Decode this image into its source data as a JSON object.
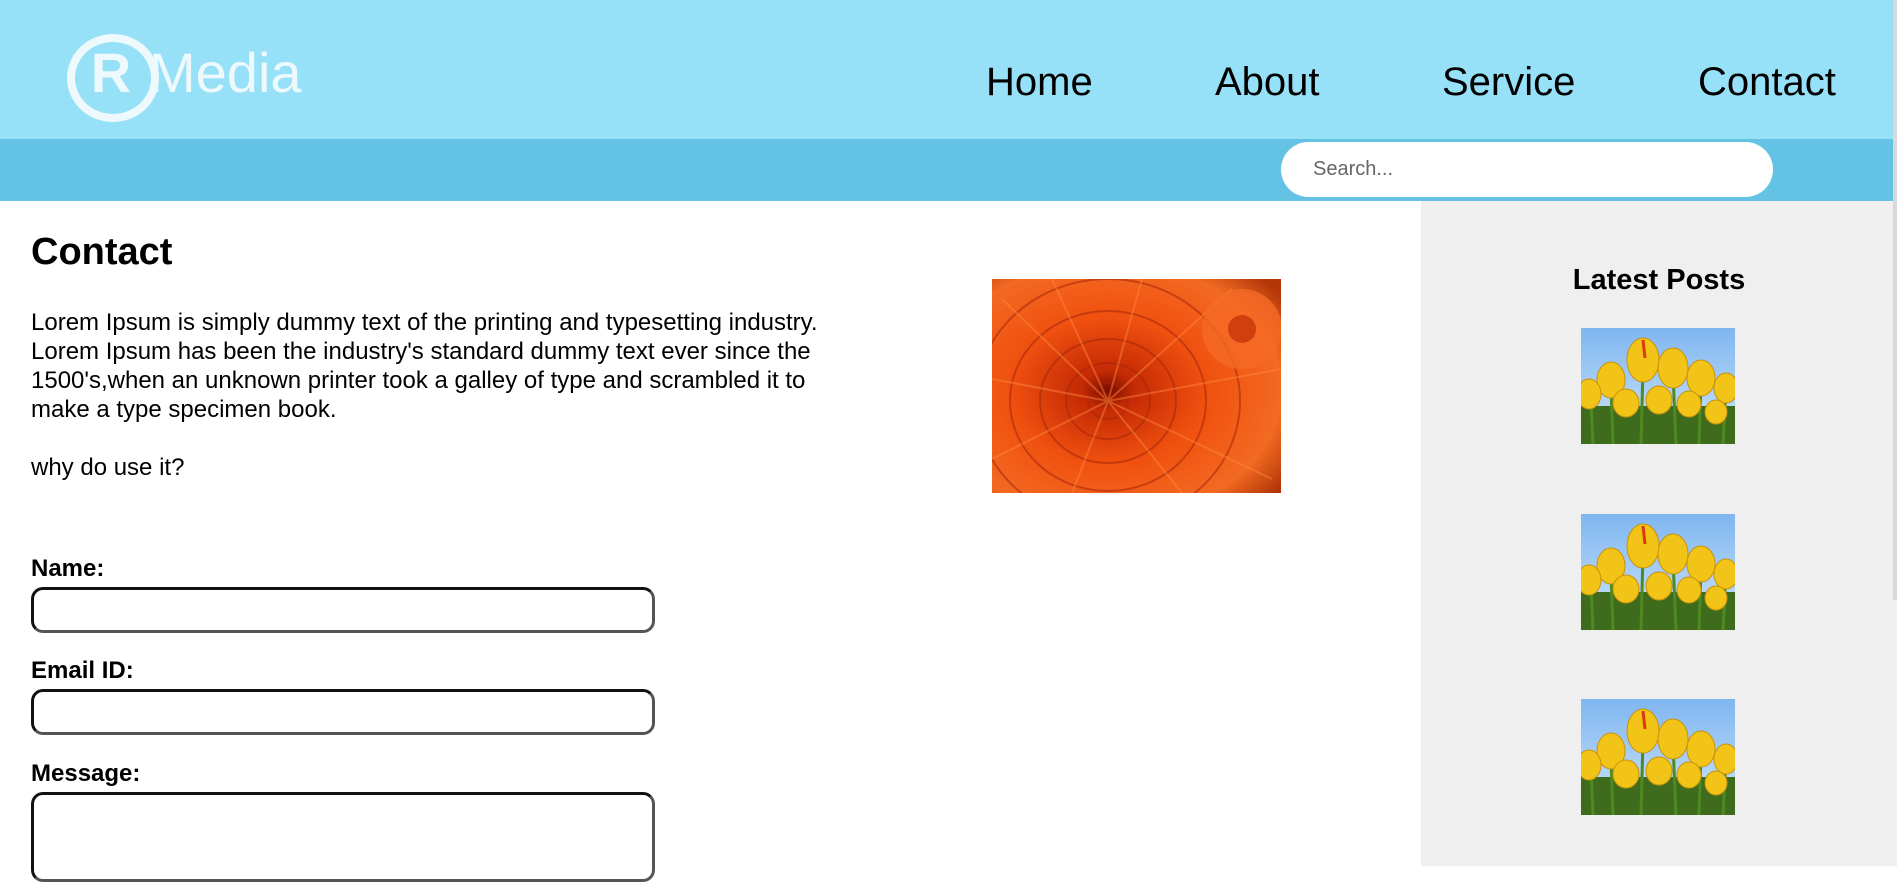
{
  "header": {
    "logo": {
      "mark_letter": "R",
      "text": "Media"
    },
    "nav": [
      {
        "label": "Home"
      },
      {
        "label": "About"
      },
      {
        "label": "Service"
      },
      {
        "label": "Contact"
      }
    ]
  },
  "search": {
    "placeholder": "Search..."
  },
  "main": {
    "title": "Contact",
    "intro": "Lorem Ipsum is simply dummy text of the printing and typesetting industry. Lorem Ipsum has been the industry's standard dummy text ever since the 1500's,when an unknown printer took a galley of type and scrambled it to make a type specimen book.",
    "question": "why do use it?",
    "form": {
      "name_label": "Name:",
      "email_label": "Email ID:",
      "message_label": "Message:",
      "name_value": "",
      "email_value": ""
    }
  },
  "sidebar": {
    "title": "Latest Posts",
    "posts": [
      {
        "image": "tulips-thumbnail"
      },
      {
        "image": "tulips-thumbnail"
      },
      {
        "image": "tulips-thumbnail"
      }
    ]
  },
  "colors": {
    "header_bg": "#96e1f7",
    "search_strip_bg": "#64c3e4",
    "sidebar_bg": "#efefef",
    "logo": "#eef9fd"
  }
}
